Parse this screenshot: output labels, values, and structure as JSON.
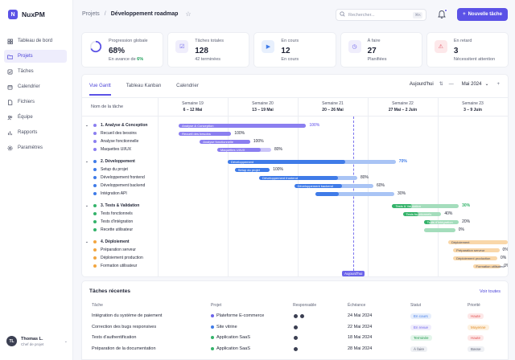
{
  "app": {
    "logo_letter": "N",
    "name": "NuxPM"
  },
  "sidebar": {
    "items": [
      {
        "label": "Tableau de bord",
        "icon": "grid-icon",
        "active": false
      },
      {
        "label": "Projets",
        "icon": "folder-icon",
        "active": true
      },
      {
        "label": "Tâches",
        "icon": "checkbox-icon",
        "active": false
      },
      {
        "label": "Calendrier",
        "icon": "calendar-icon",
        "active": false
      },
      {
        "label": "Fichiers",
        "icon": "file-icon",
        "active": false
      },
      {
        "label": "Équipe",
        "icon": "users-icon",
        "active": false
      },
      {
        "label": "Rapports",
        "icon": "chart-icon",
        "active": false
      },
      {
        "label": "Paramètres",
        "icon": "gear-icon",
        "active": false
      }
    ],
    "user": {
      "name": "Thomas L.",
      "role": "Chef de projet"
    }
  },
  "header": {
    "breadcrumb_parent": "Projets",
    "breadcrumb_sep": "/",
    "title": "Développement roadmap",
    "search_placeholder": "Rechercher...",
    "search_shortcut": "⌘K",
    "new_task_label": "Nouvelle tâche"
  },
  "stats": [
    {
      "label": "Progression globale",
      "value": "68%",
      "sub": "En avance de ",
      "sub_highlight": "6%",
      "icon": "progress-ring-icon",
      "progress": 0.68
    },
    {
      "label": "Tâches totales",
      "value": "128",
      "sub": "42 terminées",
      "icon": "checklist-icon"
    },
    {
      "label": "En cours",
      "value": "12",
      "sub": "En cours",
      "icon": "play-icon"
    },
    {
      "label": "À faire",
      "value": "27",
      "sub": "Planifiées",
      "icon": "clock-icon"
    },
    {
      "label": "En retard",
      "value": "3",
      "sub": "Nécessitent attention",
      "icon": "alert-icon"
    }
  ],
  "gantt": {
    "tabs": [
      "Vue Gantt",
      "Tableau Kanban",
      "Calendrier"
    ],
    "today_label": "Aujourd'hui",
    "month_label": "Mai 2024",
    "column_name_label": "Nom de la tâche",
    "weeks": [
      {
        "title": "Semaine 19",
        "dates": "6 – 12 Mai"
      },
      {
        "title": "Semaine 20",
        "dates": "13 – 19 Mai"
      },
      {
        "title": "Semaine 21",
        "dates": "20 – 26 Mai"
      },
      {
        "title": "Semaine 22",
        "dates": "27 Mai – 2 Juin"
      },
      {
        "title": "Semaine 23",
        "dates": "3 – 9 Juin"
      }
    ],
    "today_badge": "Aujourd'hui",
    "groups": [
      {
        "name": "1. Analyse & Conception",
        "color": "#8b7ff0",
        "bar_label": "Analyse & Conception",
        "percent": "100%",
        "progress": 1.0,
        "start": 0.3,
        "end": 2.12,
        "tasks": [
          {
            "name": "Recueil des besoins",
            "bar_label": "Recueil des besoins",
            "percent": "100%",
            "progress": 1.0,
            "start": 0.3,
            "end": 1.05
          },
          {
            "name": "Analyse fonctionnelle",
            "bar_label": "Analyse fonctionnelle",
            "percent": "100%",
            "progress": 1.0,
            "start": 0.6,
            "end": 1.32
          },
          {
            "name": "Maquettes UI/UX",
            "bar_label": "Maquettes UI/UX",
            "percent": "80%",
            "progress": 0.8,
            "start": 0.85,
            "end": 1.62
          }
        ]
      },
      {
        "name": "2. Développement",
        "color": "#3f7be8",
        "bar_label": "Développement",
        "percent": "70%",
        "progress": 0.7,
        "start": 1.0,
        "end": 3.4,
        "tasks": [
          {
            "name": "Setup du projet",
            "bar_label": "Setup du projet",
            "percent": "100%",
            "progress": 1.0,
            "start": 1.1,
            "end": 1.6
          },
          {
            "name": "Développement frontend",
            "bar_label": "Développement frontend",
            "percent": "80%",
            "progress": 0.8,
            "start": 1.45,
            "end": 2.85
          },
          {
            "name": "Développement backend",
            "bar_label": "Développement backend",
            "percent": "60%",
            "progress": 0.6,
            "start": 1.95,
            "end": 3.08
          },
          {
            "name": "Intégration API",
            "bar_label": "",
            "percent": "30%",
            "progress": 0.3,
            "start": 2.25,
            "end": 3.38
          }
        ]
      },
      {
        "name": "3. Tests & Validation",
        "color": "#34b36a",
        "bar_label": "Tests & Validation",
        "percent": "30%",
        "progress": 0.3,
        "start": 3.35,
        "end": 4.3,
        "tasks": [
          {
            "name": "Tests fonctionnels",
            "bar_label": "Tests fonctionnels",
            "percent": "40%",
            "progress": 0.4,
            "start": 3.5,
            "end": 4.05
          },
          {
            "name": "Tests d'intégration",
            "bar_label": "Tests d'intégration",
            "percent": "20%",
            "progress": 0.2,
            "start": 3.8,
            "end": 4.3
          },
          {
            "name": "Recette utilisateur",
            "bar_label": "",
            "percent": "0%",
            "progress": 0.0,
            "start": 3.8,
            "end": 4.25
          }
        ]
      },
      {
        "name": "4. Déploiement",
        "color": "#f2a640",
        "bar_label": "Déploiement",
        "percent": "0%",
        "progress": 0.0,
        "start": 4.15,
        "end": 5.0,
        "tasks": [
          {
            "name": "Préparation serveur",
            "bar_label": "Préparation serveur",
            "percent": "0%",
            "progress": 0.0,
            "start": 4.22,
            "end": 4.88
          },
          {
            "name": "Déploiement production",
            "bar_label": "Déploiement production",
            "percent": "0%",
            "progress": 0.0,
            "start": 4.22,
            "end": 4.85
          },
          {
            "name": "Formation utilisateur",
            "bar_label": "Formation utilisateur",
            "percent": "0%",
            "progress": 0.0,
            "start": 4.5,
            "end": 4.9
          }
        ]
      }
    ]
  },
  "recent": {
    "title": "Tâches récentes",
    "view_all": "Voir toutes",
    "columns": [
      "Tâche",
      "Projet",
      "Responsable",
      "Échéance",
      "Statut",
      "Priorité"
    ],
    "rows": [
      {
        "task": "Intégration du système de paiement",
        "project": "Plateforme E-commerce",
        "project_color": "#6b63ea",
        "assignees": 2,
        "due": "24 Mai 2024",
        "status": "En cours",
        "status_bg": "#e6eefc",
        "status_fg": "#3f7be8",
        "priority": "Haute",
        "prio_bg": "#fde7e7",
        "prio_fg": "#e05252"
      },
      {
        "task": "Correction des bugs responsives",
        "project": "Site vitrine",
        "project_color": "#3f7be8",
        "assignees": 1,
        "due": "22 Mai 2024",
        "status": "En revue",
        "status_bg": "#f0edfc",
        "status_fg": "#6b63ea",
        "priority": "Moyenne",
        "prio_bg": "#fdf1e0",
        "prio_fg": "#e08a20"
      },
      {
        "task": "Tests d'authentification",
        "project": "Application SaaS",
        "project_color": "#34b36a",
        "assignees": 1,
        "due": "18 Mai 2024",
        "status": "Terminée",
        "status_bg": "#e3f5ea",
        "status_fg": "#22994f",
        "priority": "Haute",
        "prio_bg": "#fde7e7",
        "prio_fg": "#e05252"
      },
      {
        "task": "Préparation de la documentation",
        "project": "Application SaaS",
        "project_color": "#34b36a",
        "assignees": 1,
        "due": "28 Mai 2024",
        "status": "À faire",
        "status_bg": "#eef0f4",
        "status_fg": "#5f6477",
        "priority": "Basse",
        "prio_bg": "#eef0f4",
        "prio_fg": "#5f6477"
      }
    ]
  }
}
